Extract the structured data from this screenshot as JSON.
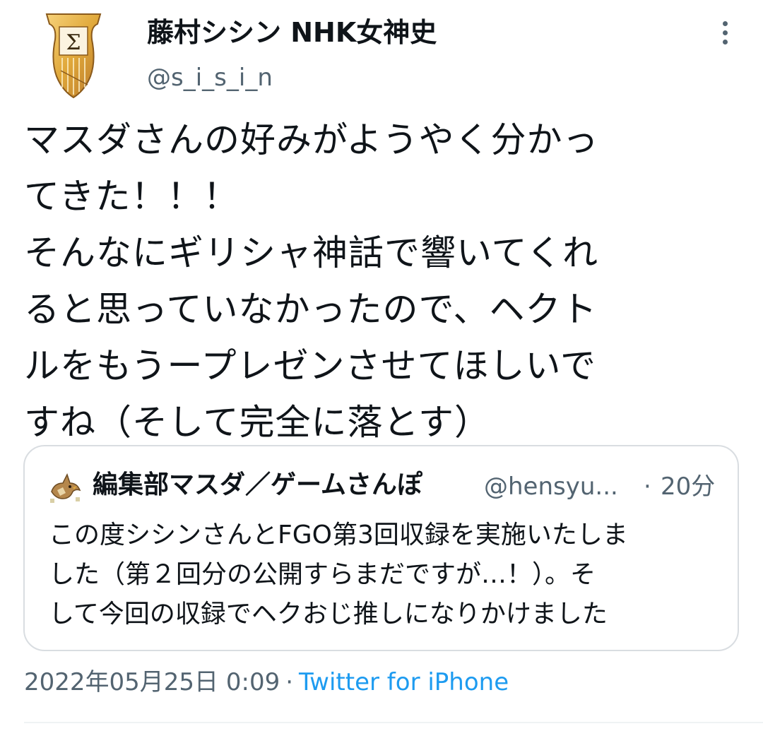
{
  "author": {
    "display_name": "藤村シシン NHK女神史",
    "handle": "@s_i_s_i_n",
    "avatar_icon": "lyre-sigma-avatar"
  },
  "tweet": {
    "text": "マスダさんの好みがようやく分かっ\nてきた！！！\nそんなにギリシャ神話で響いてくれ\nると思っていなかったので、ヘクト\nルをもうープレゼンさせてほしいで\nすね（そして完全に落とす）"
  },
  "quote": {
    "display_name": "編集部マスダ／ゲームさんぽ",
    "handle": "@hensyu...",
    "dot": "·",
    "time": "20分",
    "avatar_icon": "bird-avatar",
    "text": "この度シシンさんとFGO第3回収録を実施いたしま\nした（第２回分の公開すらまだですが…！）。そ\nして今回の収録でヘクおじ推しになりかけました"
  },
  "meta": {
    "date": "2022年05月25日 0:09",
    "separator": "·",
    "source": "Twitter for iPhone"
  },
  "colors": {
    "text": "#0f1419",
    "secondary": "#536471",
    "link": "#1d9bf0",
    "border": "#d9dde1"
  }
}
